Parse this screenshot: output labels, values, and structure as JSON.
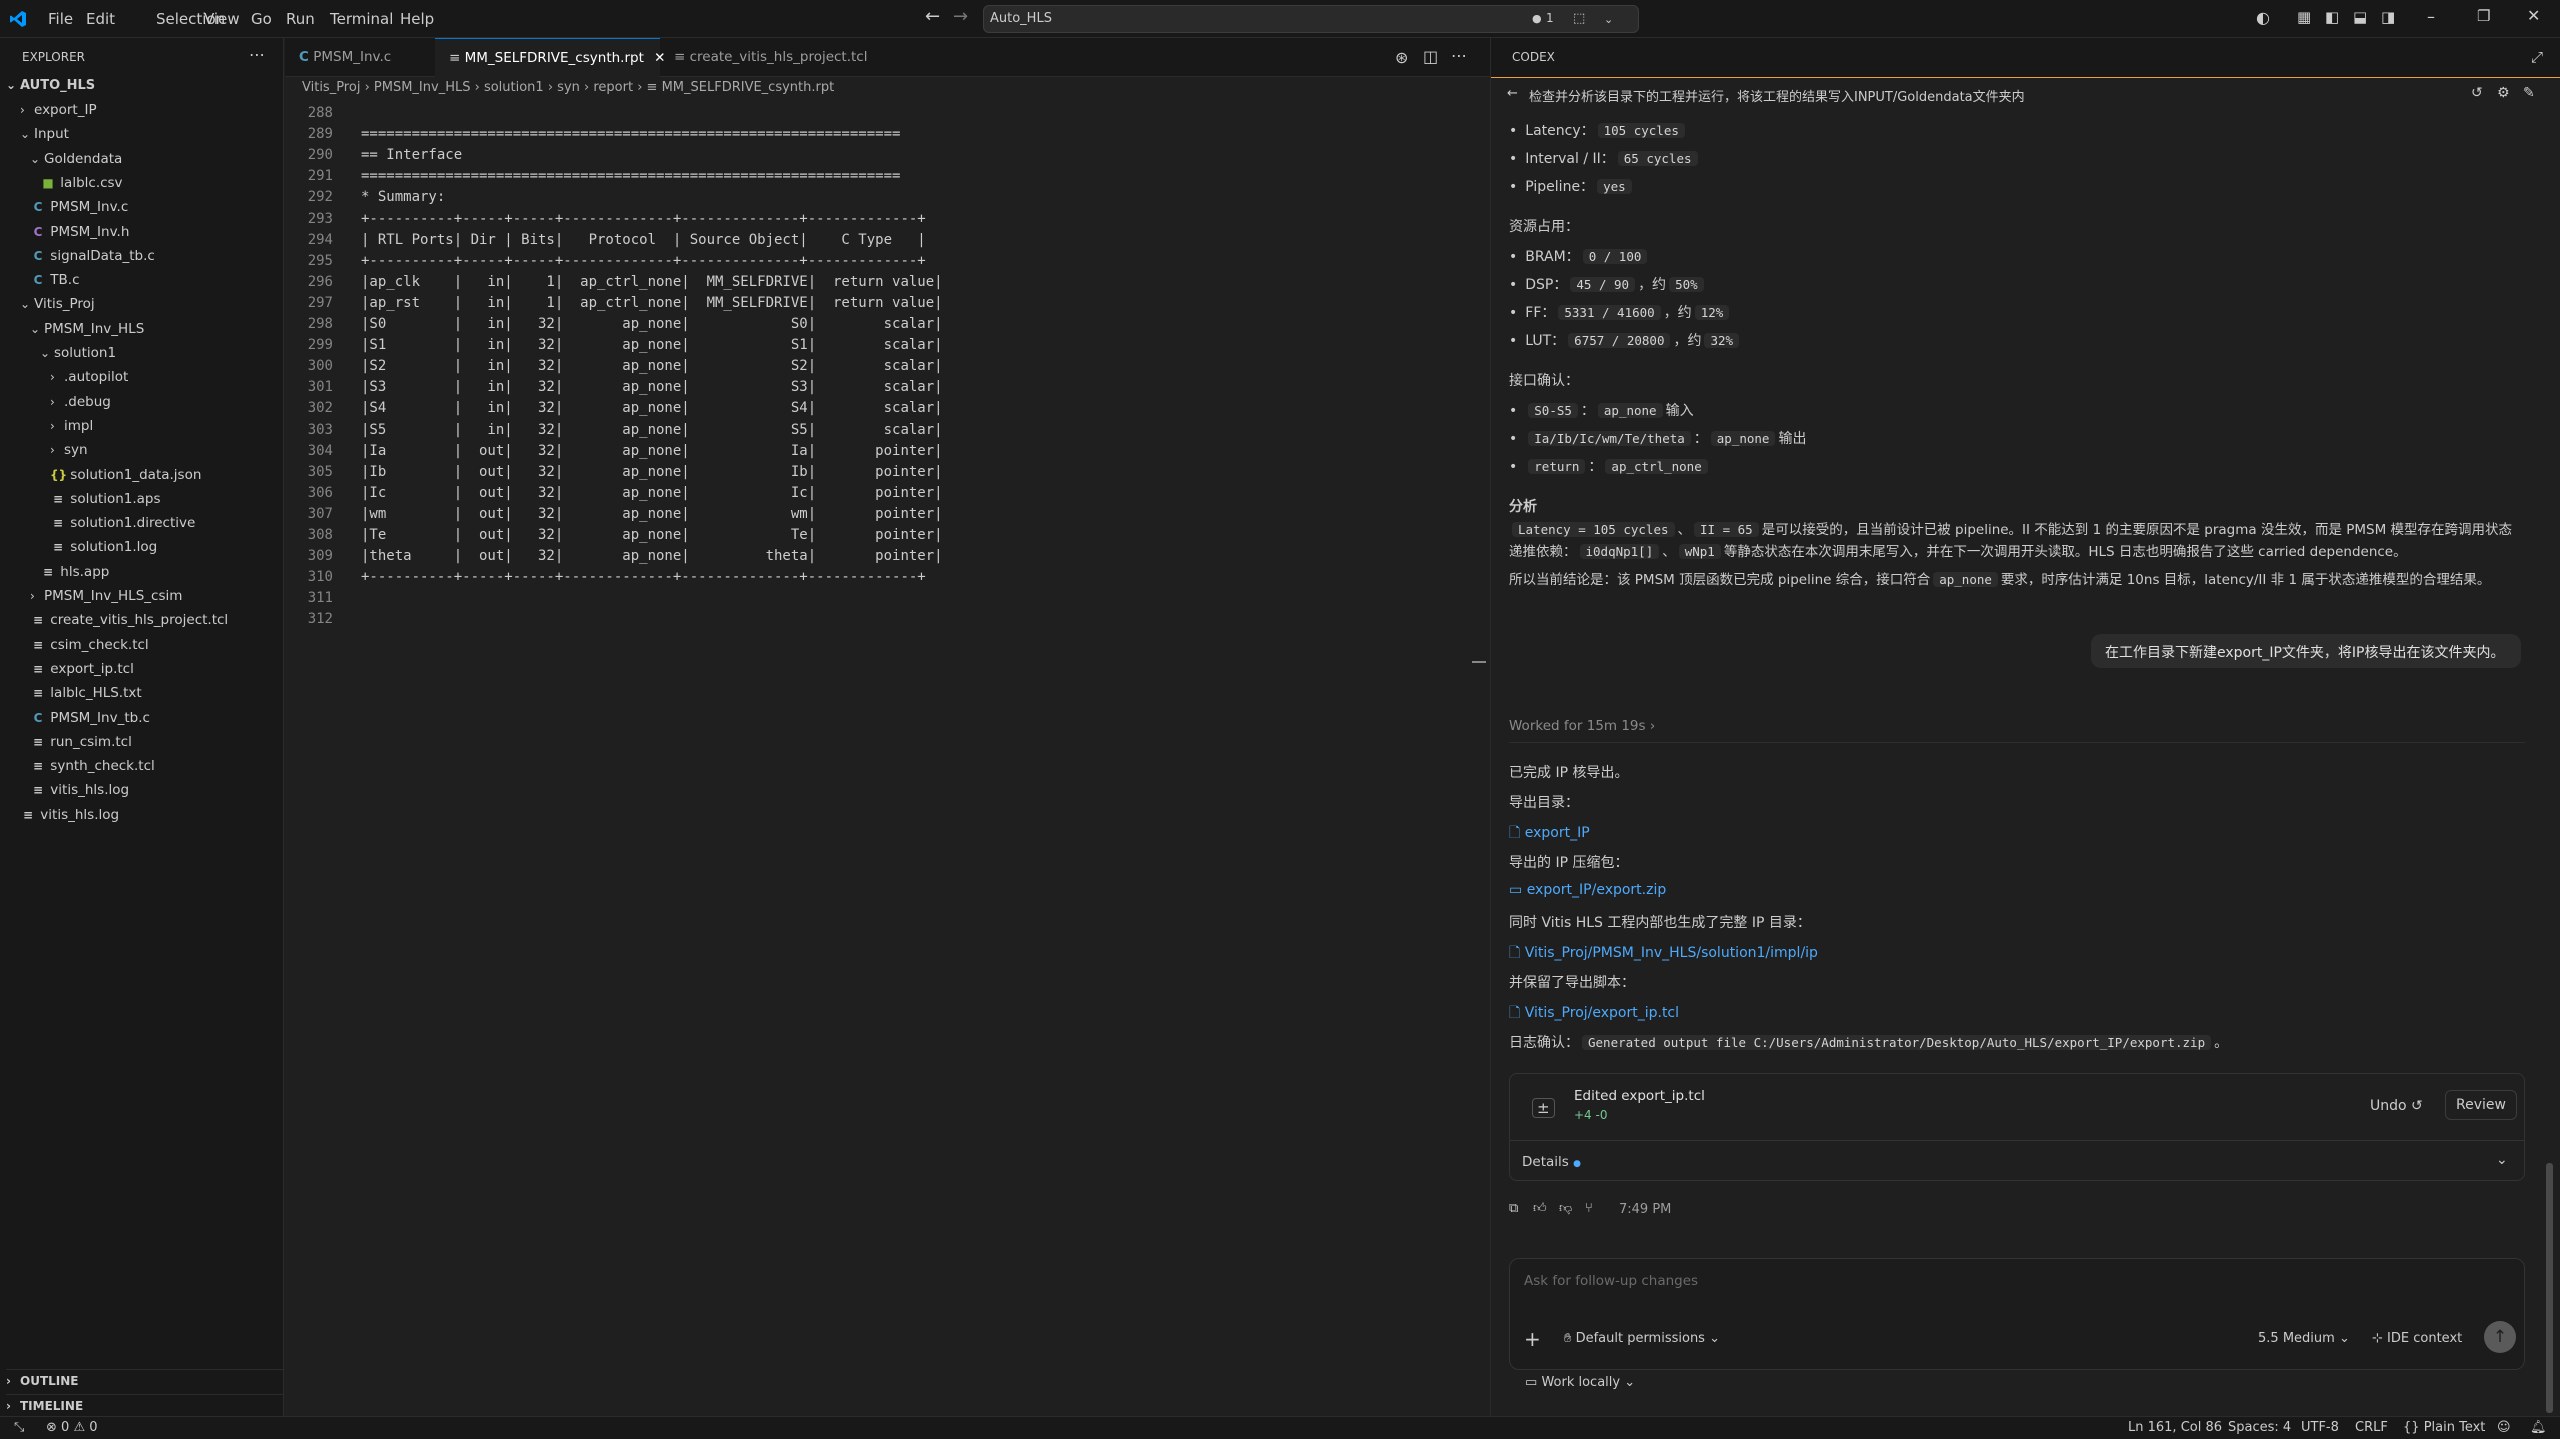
{
  "menu": [
    "File",
    "Edit",
    "Selection",
    "View",
    "Go",
    "Run",
    "Terminal",
    "Help"
  ],
  "command_center": {
    "text": "Auto_HLS",
    "badge": "1"
  },
  "explorer": {
    "title": "EXPLORER",
    "root": "AUTO_HLS",
    "items": [
      {
        "label": "export_IP",
        "depth": 1,
        "type": "folder",
        "open": false
      },
      {
        "label": "Input",
        "depth": 1,
        "type": "folder",
        "open": true
      },
      {
        "label": "Goldendata",
        "depth": 2,
        "type": "folder",
        "open": true
      },
      {
        "label": "lalblc.csv",
        "depth": 3,
        "type": "csv"
      },
      {
        "label": "PMSM_Inv.c",
        "depth": 2,
        "type": "c"
      },
      {
        "label": "PMSM_Inv.h",
        "depth": 2,
        "type": "h"
      },
      {
        "label": "signalData_tb.c",
        "depth": 2,
        "type": "c"
      },
      {
        "label": "TB.c",
        "depth": 2,
        "type": "c"
      },
      {
        "label": "Vitis_Proj",
        "depth": 1,
        "type": "folder",
        "open": true
      },
      {
        "label": "PMSM_Inv_HLS",
        "depth": 2,
        "type": "folder",
        "open": true
      },
      {
        "label": "solution1",
        "depth": 3,
        "type": "folder",
        "open": true
      },
      {
        "label": ".autopilot",
        "depth": 4,
        "type": "folder",
        "open": false
      },
      {
        "label": ".debug",
        "depth": 4,
        "type": "folder",
        "open": false
      },
      {
        "label": "impl",
        "depth": 4,
        "type": "folder",
        "open": false
      },
      {
        "label": "syn",
        "depth": 4,
        "type": "folder",
        "open": false
      },
      {
        "label": "solution1_data.json",
        "depth": 4,
        "type": "json"
      },
      {
        "label": "solution1.aps",
        "depth": 4,
        "type": "txt"
      },
      {
        "label": "solution1.directive",
        "depth": 4,
        "type": "txt"
      },
      {
        "label": "solution1.log",
        "depth": 4,
        "type": "txt"
      },
      {
        "label": "hls.app",
        "depth": 3,
        "type": "txt"
      },
      {
        "label": "PMSM_Inv_HLS_csim",
        "depth": 2,
        "type": "folder",
        "open": false
      },
      {
        "label": "create_vitis_hls_project.tcl",
        "depth": 2,
        "type": "txt"
      },
      {
        "label": "csim_check.tcl",
        "depth": 2,
        "type": "txt"
      },
      {
        "label": "export_ip.tcl",
        "depth": 2,
        "type": "txt"
      },
      {
        "label": "lalblc_HLS.txt",
        "depth": 2,
        "type": "txt"
      },
      {
        "label": "PMSM_Inv_tb.c",
        "depth": 2,
        "type": "c"
      },
      {
        "label": "run_csim.tcl",
        "depth": 2,
        "type": "txt"
      },
      {
        "label": "synth_check.tcl",
        "depth": 2,
        "type": "txt"
      },
      {
        "label": "vitis_hls.log",
        "depth": 2,
        "type": "txt"
      },
      {
        "label": "vitis_hls.log",
        "depth": 1,
        "type": "txt"
      }
    ],
    "outline": "OUTLINE",
    "timeline": "TIMELINE"
  },
  "tabs": [
    {
      "label": "PMSM_Inv.c",
      "icon": "C",
      "active": false
    },
    {
      "label": "MM_SELFDRIVE_csynth.rpt",
      "icon": "≡",
      "active": true
    },
    {
      "label": "create_vitis_hls_project.tcl",
      "icon": "≡",
      "active": false
    }
  ],
  "breadcrumb": [
    "Vitis_Proj",
    "PMSM_Inv_HLS",
    "solution1",
    "syn",
    "report",
    "MM_SELFDRIVE_csynth.rpt"
  ],
  "code_lines": [
    {
      "n": "288",
      "t": ""
    },
    {
      "n": "289",
      "t": "================================================================"
    },
    {
      "n": "290",
      "t": "== Interface"
    },
    {
      "n": "291",
      "t": "================================================================"
    },
    {
      "n": "292",
      "t": "* Summary:"
    },
    {
      "n": "293",
      "t": "+----------+-----+-----+-------------+--------------+-------------+"
    },
    {
      "n": "294",
      "t": "| RTL Ports| Dir | Bits|   Protocol  | Source Object|    C Type   |"
    },
    {
      "n": "295",
      "t": "+----------+-----+-----+-------------+--------------+-------------+"
    },
    {
      "n": "296",
      "t": "|ap_clk    |   in|    1|  ap_ctrl_none|  MM_SELFDRIVE|  return value|"
    },
    {
      "n": "297",
      "t": "|ap_rst    |   in|    1|  ap_ctrl_none|  MM_SELFDRIVE|  return value|"
    },
    {
      "n": "298",
      "t": "|S0        |   in|   32|       ap_none|            S0|        scalar|"
    },
    {
      "n": "299",
      "t": "|S1        |   in|   32|       ap_none|            S1|        scalar|"
    },
    {
      "n": "300",
      "t": "|S2        |   in|   32|       ap_none|            S2|        scalar|"
    },
    {
      "n": "301",
      "t": "|S3        |   in|   32|       ap_none|            S3|        scalar|"
    },
    {
      "n": "302",
      "t": "|S4        |   in|   32|       ap_none|            S4|        scalar|"
    },
    {
      "n": "303",
      "t": "|S5        |   in|   32|       ap_none|            S5|        scalar|"
    },
    {
      "n": "304",
      "t": "|Ia        |  out|   32|       ap_none|            Ia|       pointer|"
    },
    {
      "n": "305",
      "t": "|Ib        |  out|   32|       ap_none|            Ib|       pointer|"
    },
    {
      "n": "306",
      "t": "|Ic        |  out|   32|       ap_none|            Ic|       pointer|"
    },
    {
      "n": "307",
      "t": "|wm        |  out|   32|       ap_none|            wm|       pointer|"
    },
    {
      "n": "308",
      "t": "|Te        |  out|   32|       ap_none|            Te|       pointer|"
    },
    {
      "n": "309",
      "t": "|theta     |  out|   32|       ap_none|         theta|       pointer|"
    },
    {
      "n": "310",
      "t": "+----------+-----+-----+-------------+--------------+-------------+"
    },
    {
      "n": "311",
      "t": ""
    },
    {
      "n": "312",
      "t": ""
    }
  ],
  "codex": {
    "title": "CODEX",
    "task": "检查并分析该目录下的工程并运行，将该工程的结果写入INPUT/Goldendata文件夹内",
    "latency_label": "Latency：",
    "latency_val": "105 cycles",
    "interval_label": "Interval / II：",
    "interval_val": "65 cycles",
    "pipeline_label": "Pipeline：",
    "pipeline_val": "yes",
    "res_heading": "资源占用：",
    "bram_label": "BRAM：",
    "bram_val": "0 / 100",
    "dsp_label": "DSP：",
    "dsp_val": "45 / 90",
    "dsp_pct": "50%",
    "ff_label": "FF：",
    "ff_val": "5331 / 41600",
    "ff_pct": "12%",
    "lut_label": "LUT：",
    "lut_val": "6757 / 20800",
    "lut_pct": "32%",
    "approx": "，约",
    "iface_heading": "接口确认：",
    "if1_a": "S0-S5",
    "if1_b": "ap_none",
    "if1_c": "输入",
    "if2_a": "Ia/Ib/Ic/wm/Te/theta",
    "if2_b": "ap_none",
    "if2_c": "输出",
    "if3_a": "return",
    "if3_b": "ap_ctrl_none",
    "analysis_heading": "分析",
    "analysis_p1_a": "Latency = 105 cycles",
    "analysis_p1_b": "II = 65",
    "analysis_p1_c": "是可以接受的，且当前设计已被 pipeline。II 不能达到 1 的主要原因不是 pragma 没生效，而是 PMSM 模型存在跨调用状态",
    "analysis_p1_d": "递推依赖：",
    "analysis_p1_e": "i0dqNp1[]",
    "analysis_p1_f": "wNp1",
    "analysis_p1_g": "等静态状态在本次调用末尾写入，并在下一次调用开头读取。HLS 日志也明确报告了这些 carried dependence。",
    "analysis_p2_a": "所以当前结论是：该 PMSM 顶层函数已完成 pipeline 综合，接口符合",
    "analysis_p2_b": "ap_none",
    "analysis_p2_c": "要求，时序估计满足 10ns 目标，latency/II 非 1 属于状态递推模型的合理结果。",
    "user_message": "在工作目录下新建export_IP文件夹，将IP核导出在该文件夹内。",
    "worked": "Worked for 15m 19s",
    "done": "已完成 IP 核导出。",
    "export_dir_label": "导出目录：",
    "export_dir": "export_IP",
    "zip_label": "导出的 IP 压缩包：",
    "zip": "export_IP/export.zip",
    "also_label": "同时 Vitis HLS 工程内部也生成了完整 IP 目录：",
    "ip_dir": "Vitis_Proj/PMSM_Inv_HLS/solution1/impl/ip",
    "script_label": "并保留了导出脚本：",
    "script": "Vitis_Proj/export_ip.tcl",
    "log_label": "日志确认：",
    "log_val": "Generated output file C:/Users/Administrator/Desktop/Auto_HLS/export_IP/export.zip",
    "log_end": "。",
    "edited_file": "Edited export_ip.tcl",
    "diff": "+4 -0",
    "undo": "Undo",
    "review": "Review",
    "details": "Details",
    "time": "7:49 PM",
    "input_placeholder": "Ask for follow-up changes",
    "permissions": "Default permissions",
    "model": "5.5",
    "effort": "Medium",
    "ide_context": "IDE context",
    "work_locally": "Work locally"
  },
  "status": {
    "errors": "0",
    "warnings": "0",
    "position": "Ln 161, Col 86",
    "spaces": "Spaces: 4",
    "encoding": "UTF-8",
    "eol": "CRLF",
    "language": "Plain Text"
  },
  "colors": {
    "accent": "#0078d4",
    "link": "#4daafc",
    "panel_border": "#f0a030"
  }
}
